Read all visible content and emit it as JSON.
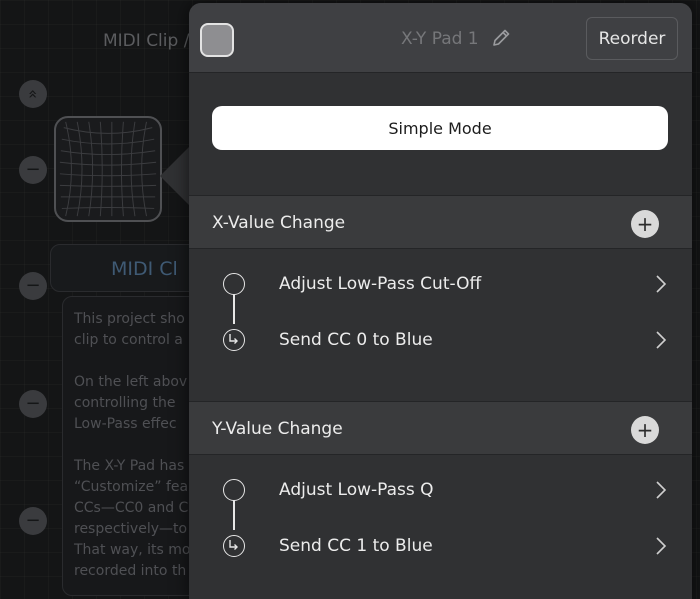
{
  "background": {
    "title": "MIDI Clip /",
    "clip_title": "MIDI Cl",
    "notes": "This project sho\nclip to control a\n\nOn the left abov\ncontrolling the\nLow-Pass effec\n\nThe X-Y Pad has\n“Customize” fea\nCCs—CC0 and C\nrespectively—to\nThat way, its mo\nrecorded into th",
    "collapse_glyph": "«",
    "remove_glyph": "−"
  },
  "header": {
    "title": "X-Y Pad 1",
    "reorder_label": "Reorder",
    "swatch_color": "#8e8e91"
  },
  "mode": {
    "simple_mode_label": "Simple Mode"
  },
  "sections": [
    {
      "title": "X-Value Change",
      "actions": [
        {
          "label": "Adjust Low-Pass Cut-Off"
        },
        {
          "label": "Send CC 0 to Blue"
        }
      ]
    },
    {
      "title": "Y-Value Change",
      "actions": [
        {
          "label": "Adjust Low-Pass Q"
        },
        {
          "label": "Send CC 1 to Blue"
        }
      ]
    }
  ],
  "add_glyph": "+",
  "icons": {
    "edit": "pencil-icon",
    "add": "plus-icon",
    "disclosure": "chevron-right-icon",
    "action_start": "circle-node-icon",
    "action_next": "return-arrow-icon"
  }
}
